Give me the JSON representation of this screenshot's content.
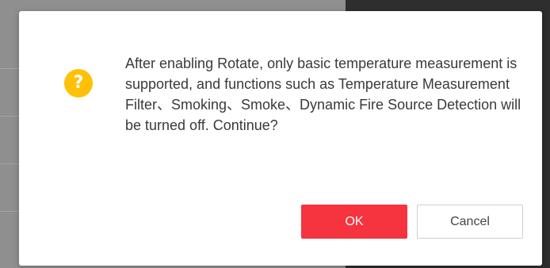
{
  "dialog": {
    "icon": "question-icon",
    "icon_glyph": "?",
    "icon_color": "#ffc107",
    "message": "After enabling Rotate, only basic temperature measurement is supported, and functions such as Temperature Measurement Filter、Smoking、Smoke、Dynamic Fire Source Detection will be turned off. Continue?",
    "ok_label": "OK",
    "cancel_label": "Cancel",
    "ok_color": "#f5343f"
  }
}
